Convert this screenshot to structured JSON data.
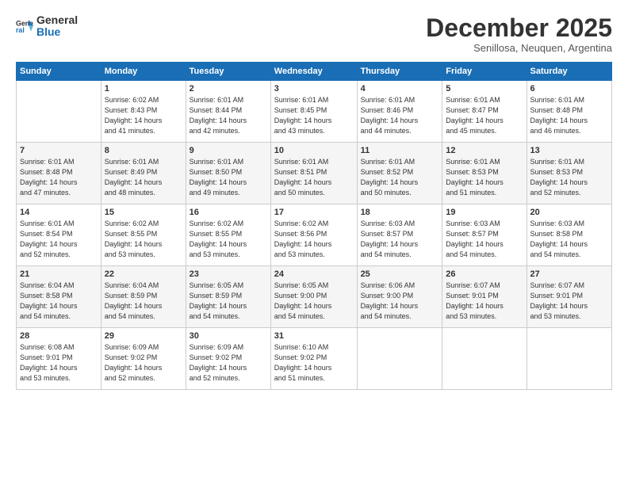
{
  "logo": {
    "general": "General",
    "blue": "Blue"
  },
  "title": "December 2025",
  "subtitle": "Senillosa, Neuquen, Argentina",
  "header_days": [
    "Sunday",
    "Monday",
    "Tuesday",
    "Wednesday",
    "Thursday",
    "Friday",
    "Saturday"
  ],
  "weeks": [
    [
      {
        "day": "",
        "info": ""
      },
      {
        "day": "1",
        "info": "Sunrise: 6:02 AM\nSunset: 8:43 PM\nDaylight: 14 hours\nand 41 minutes."
      },
      {
        "day": "2",
        "info": "Sunrise: 6:01 AM\nSunset: 8:44 PM\nDaylight: 14 hours\nand 42 minutes."
      },
      {
        "day": "3",
        "info": "Sunrise: 6:01 AM\nSunset: 8:45 PM\nDaylight: 14 hours\nand 43 minutes."
      },
      {
        "day": "4",
        "info": "Sunrise: 6:01 AM\nSunset: 8:46 PM\nDaylight: 14 hours\nand 44 minutes."
      },
      {
        "day": "5",
        "info": "Sunrise: 6:01 AM\nSunset: 8:47 PM\nDaylight: 14 hours\nand 45 minutes."
      },
      {
        "day": "6",
        "info": "Sunrise: 6:01 AM\nSunset: 8:48 PM\nDaylight: 14 hours\nand 46 minutes."
      }
    ],
    [
      {
        "day": "7",
        "info": "Sunrise: 6:01 AM\nSunset: 8:48 PM\nDaylight: 14 hours\nand 47 minutes."
      },
      {
        "day": "8",
        "info": "Sunrise: 6:01 AM\nSunset: 8:49 PM\nDaylight: 14 hours\nand 48 minutes."
      },
      {
        "day": "9",
        "info": "Sunrise: 6:01 AM\nSunset: 8:50 PM\nDaylight: 14 hours\nand 49 minutes."
      },
      {
        "day": "10",
        "info": "Sunrise: 6:01 AM\nSunset: 8:51 PM\nDaylight: 14 hours\nand 50 minutes."
      },
      {
        "day": "11",
        "info": "Sunrise: 6:01 AM\nSunset: 8:52 PM\nDaylight: 14 hours\nand 50 minutes."
      },
      {
        "day": "12",
        "info": "Sunrise: 6:01 AM\nSunset: 8:53 PM\nDaylight: 14 hours\nand 51 minutes."
      },
      {
        "day": "13",
        "info": "Sunrise: 6:01 AM\nSunset: 8:53 PM\nDaylight: 14 hours\nand 52 minutes."
      }
    ],
    [
      {
        "day": "14",
        "info": "Sunrise: 6:01 AM\nSunset: 8:54 PM\nDaylight: 14 hours\nand 52 minutes."
      },
      {
        "day": "15",
        "info": "Sunrise: 6:02 AM\nSunset: 8:55 PM\nDaylight: 14 hours\nand 53 minutes."
      },
      {
        "day": "16",
        "info": "Sunrise: 6:02 AM\nSunset: 8:55 PM\nDaylight: 14 hours\nand 53 minutes."
      },
      {
        "day": "17",
        "info": "Sunrise: 6:02 AM\nSunset: 8:56 PM\nDaylight: 14 hours\nand 53 minutes."
      },
      {
        "day": "18",
        "info": "Sunrise: 6:03 AM\nSunset: 8:57 PM\nDaylight: 14 hours\nand 54 minutes."
      },
      {
        "day": "19",
        "info": "Sunrise: 6:03 AM\nSunset: 8:57 PM\nDaylight: 14 hours\nand 54 minutes."
      },
      {
        "day": "20",
        "info": "Sunrise: 6:03 AM\nSunset: 8:58 PM\nDaylight: 14 hours\nand 54 minutes."
      }
    ],
    [
      {
        "day": "21",
        "info": "Sunrise: 6:04 AM\nSunset: 8:58 PM\nDaylight: 14 hours\nand 54 minutes."
      },
      {
        "day": "22",
        "info": "Sunrise: 6:04 AM\nSunset: 8:59 PM\nDaylight: 14 hours\nand 54 minutes."
      },
      {
        "day": "23",
        "info": "Sunrise: 6:05 AM\nSunset: 8:59 PM\nDaylight: 14 hours\nand 54 minutes."
      },
      {
        "day": "24",
        "info": "Sunrise: 6:05 AM\nSunset: 9:00 PM\nDaylight: 14 hours\nand 54 minutes."
      },
      {
        "day": "25",
        "info": "Sunrise: 6:06 AM\nSunset: 9:00 PM\nDaylight: 14 hours\nand 54 minutes."
      },
      {
        "day": "26",
        "info": "Sunrise: 6:07 AM\nSunset: 9:01 PM\nDaylight: 14 hours\nand 53 minutes."
      },
      {
        "day": "27",
        "info": "Sunrise: 6:07 AM\nSunset: 9:01 PM\nDaylight: 14 hours\nand 53 minutes."
      }
    ],
    [
      {
        "day": "28",
        "info": "Sunrise: 6:08 AM\nSunset: 9:01 PM\nDaylight: 14 hours\nand 53 minutes."
      },
      {
        "day": "29",
        "info": "Sunrise: 6:09 AM\nSunset: 9:02 PM\nDaylight: 14 hours\nand 52 minutes."
      },
      {
        "day": "30",
        "info": "Sunrise: 6:09 AM\nSunset: 9:02 PM\nDaylight: 14 hours\nand 52 minutes."
      },
      {
        "day": "31",
        "info": "Sunrise: 6:10 AM\nSunset: 9:02 PM\nDaylight: 14 hours\nand 51 minutes."
      },
      {
        "day": "",
        "info": ""
      },
      {
        "day": "",
        "info": ""
      },
      {
        "day": "",
        "info": ""
      }
    ]
  ]
}
